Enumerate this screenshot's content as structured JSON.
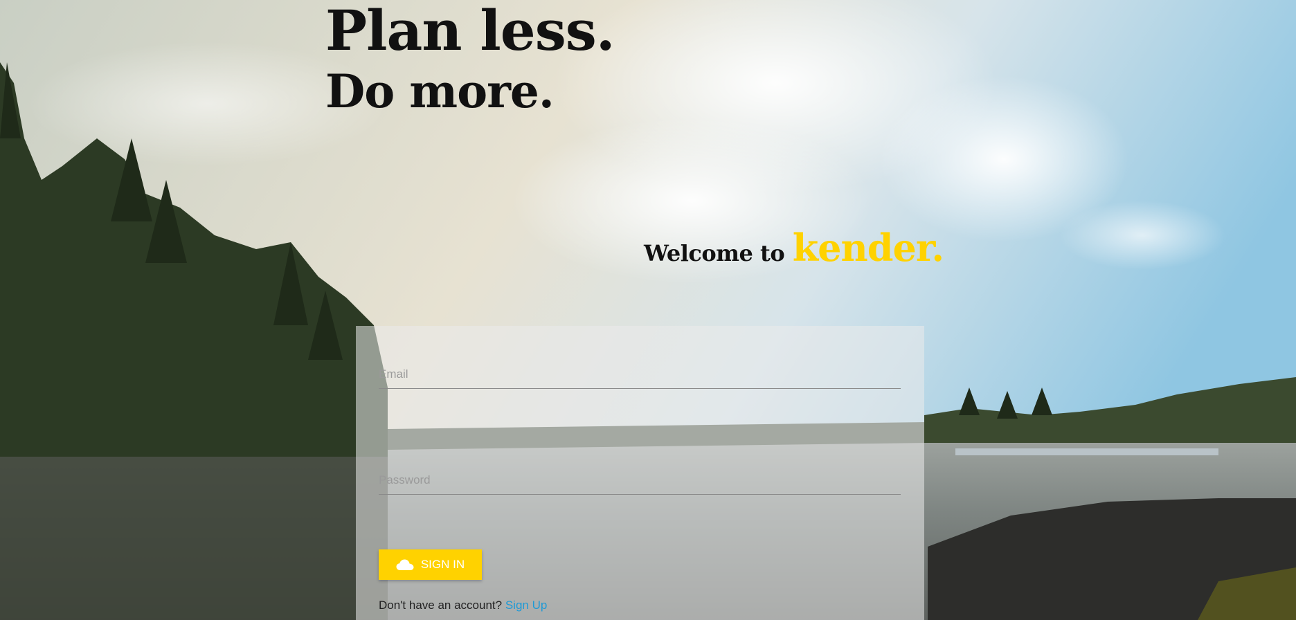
{
  "hero": {
    "line1": "Plan less.",
    "line2": "Do more."
  },
  "welcome": {
    "prefix": "Welcome to",
    "brand": "kender."
  },
  "login": {
    "email_placeholder": "Email",
    "email_value": "",
    "password_placeholder": "Password",
    "password_value": "",
    "signin_label": "SIGN IN",
    "signin_icon": "cloud-icon",
    "no_account_text": "Don't have an account?",
    "signup_link": "Sign Up"
  },
  "colors": {
    "brand_yellow": "#ffd200",
    "link_blue": "#1e9ad6",
    "headline_text": "#111111"
  }
}
